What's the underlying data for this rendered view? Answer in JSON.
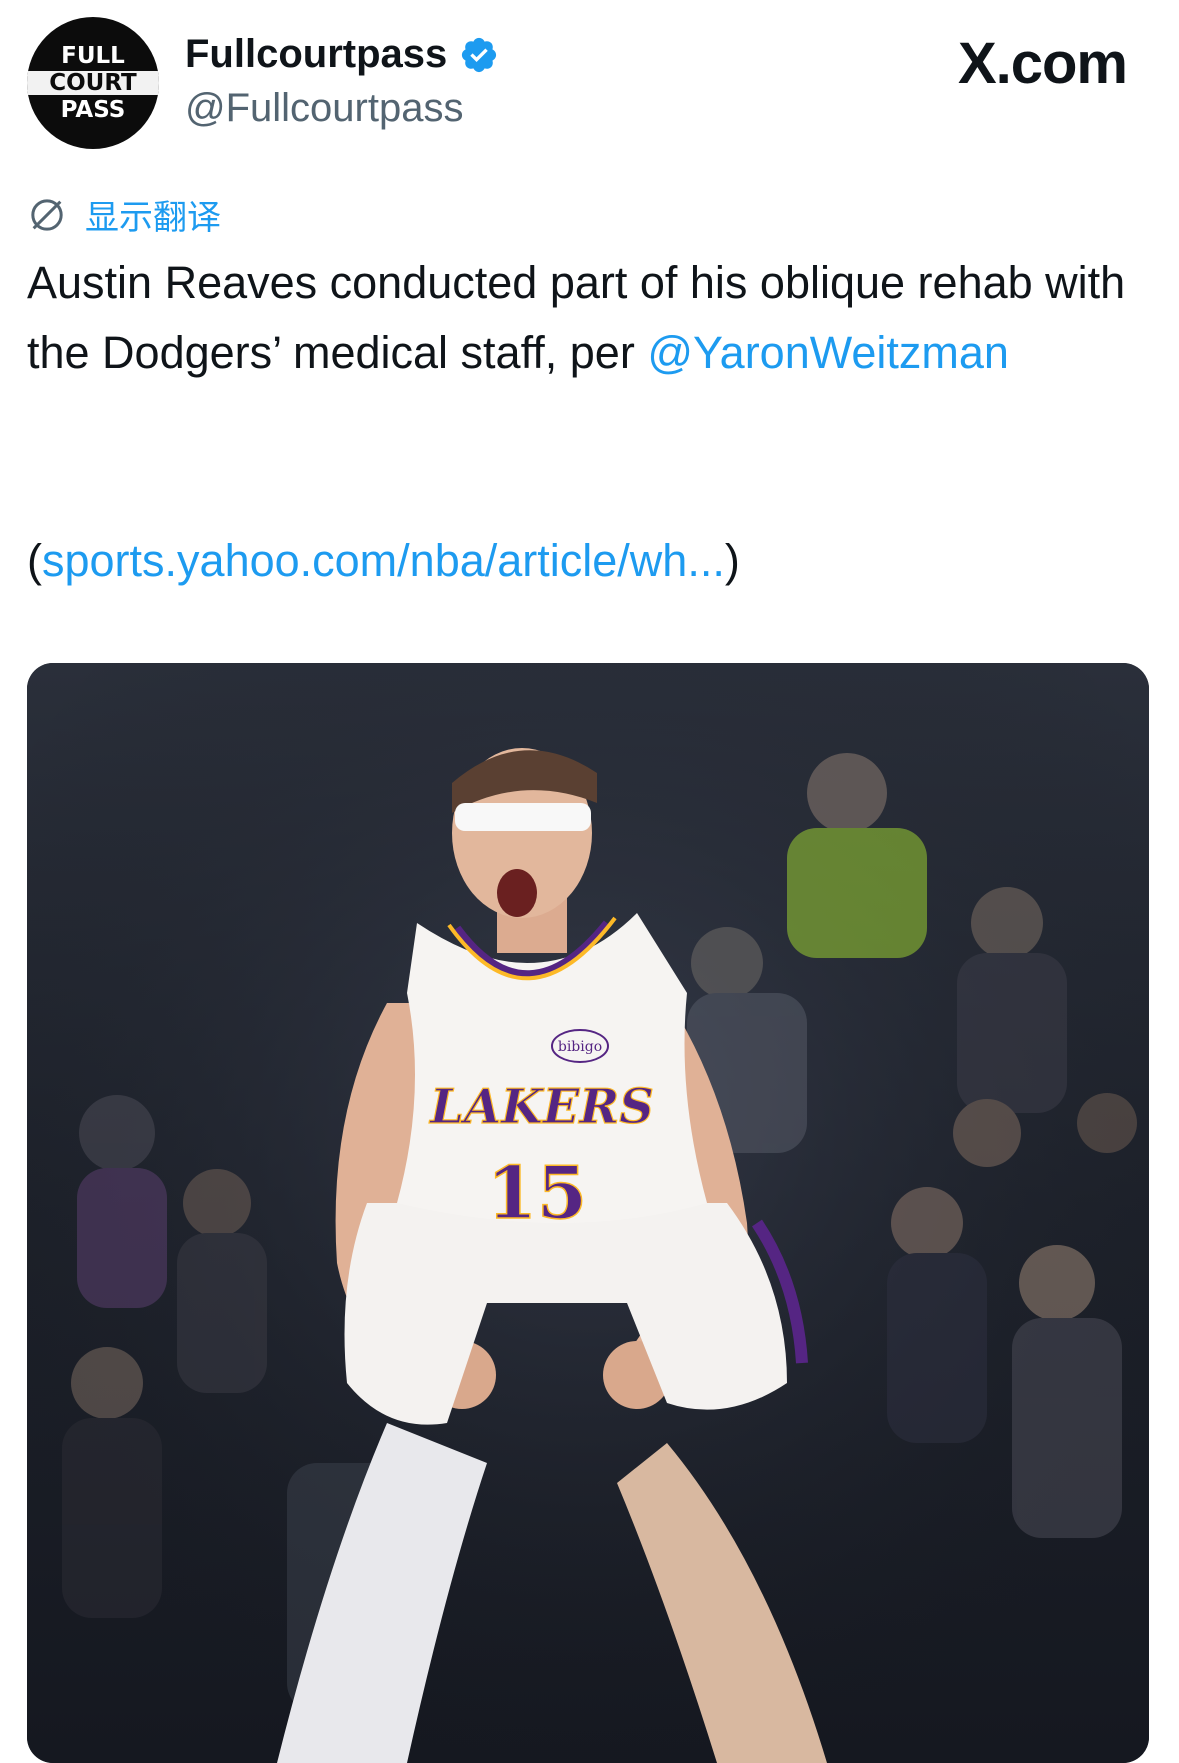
{
  "header": {
    "avatar_logo_lines": [
      "FULL",
      "COURT",
      "PASS"
    ],
    "display_name": "Fullcourtpass",
    "handle": "@Fullcourtpass",
    "verified_icon": "verified-badge-icon",
    "source_label": "X.com"
  },
  "translate": {
    "icon": "globe-icon",
    "label": "显示翻译"
  },
  "tweet": {
    "text": "Austin Reaves conducted part of his oblique rehab with the Dodgers’ medical staff, per ",
    "mention": "@YaronWeitzman",
    "link_prefix": "(",
    "link_text": "sports.yahoo.com/nba/article/wh...",
    "link_suffix": ")"
  },
  "media": {
    "jersey_sponsor": "bibigo",
    "jersey_team": "LAKERS",
    "jersey_number": "15"
  },
  "colors": {
    "link": "#1d9bf0",
    "text": "#0f1419",
    "secondary": "#536471",
    "lakers_purple": "#552583",
    "lakers_gold": "#fdb927"
  }
}
